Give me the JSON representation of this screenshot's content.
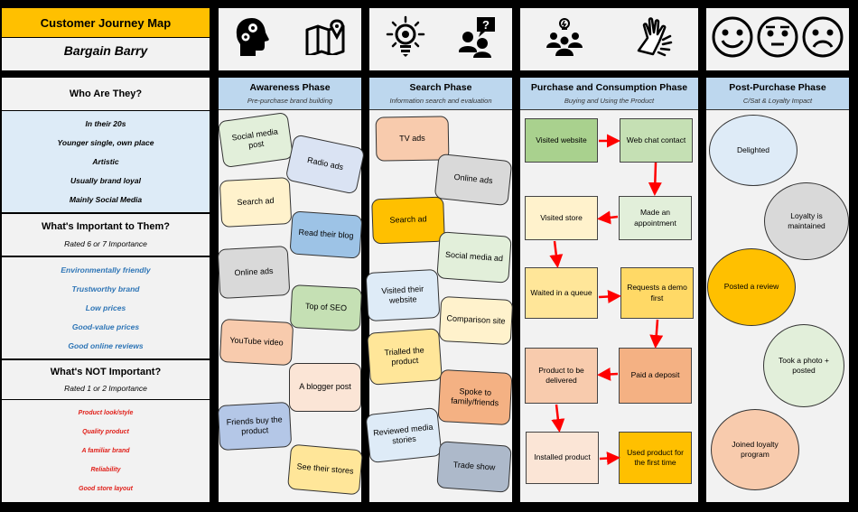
{
  "header": {
    "title": "Customer Journey Map",
    "persona": "Bargain Barry"
  },
  "left": {
    "who": {
      "heading": "Who Are They?",
      "items": [
        "In their 20s",
        "Younger single, own place",
        "Artistic",
        "Usually brand loyal",
        "Mainly Social Media"
      ]
    },
    "important": {
      "heading": "What's Important to Them?",
      "subheading": "Rated 6 or 7 Importance",
      "items": [
        "Environmentally friendly",
        "Trustworthy brand",
        "Low prices",
        "Good-value prices",
        "Good online reviews"
      ]
    },
    "not_important": {
      "heading": "What's NOT Important?",
      "subheading": "Rated 1 or 2 Importance",
      "items": [
        "Product look/style",
        "Quality product",
        "A familiar brand",
        "Reliability",
        "Good store layout"
      ]
    }
  },
  "phases": [
    {
      "title": "Awareness Phase",
      "subtitle": "Pre-purchase brand building",
      "icons": [
        "head-gears-icon",
        "map-pin-icon"
      ],
      "cards": [
        {
          "label": "Social media post",
          "color": "#e2efda"
        },
        {
          "label": "Radio ads",
          "color": "#dae3f3"
        },
        {
          "label": "Search ad",
          "color": "#fff2cc"
        },
        {
          "label": "Read their blog",
          "color": "#9dc3e6"
        },
        {
          "label": "Online ads",
          "color": "#d9d9d9"
        },
        {
          "label": "Top of SEO",
          "color": "#c5e0b4"
        },
        {
          "label": "YouTube video",
          "color": "#f8cbad"
        },
        {
          "label": "A blogger post",
          "color": "#fbe5d6"
        },
        {
          "label": "Friends buy the product",
          "color": "#b4c7e7"
        },
        {
          "label": "See their stores",
          "color": "#ffe699"
        }
      ]
    },
    {
      "title": "Search Phase",
      "subtitle": "Information search and evaluation",
      "icons": [
        "lightbulb-gear-icon",
        "people-question-icon"
      ],
      "cards": [
        {
          "label": "TV ads",
          "color": "#f8cbad"
        },
        {
          "label": "Online ads",
          "color": "#d9d9d9"
        },
        {
          "label": "Search ad",
          "color": "#ffc000"
        },
        {
          "label": "Social media ad",
          "color": "#e2efda"
        },
        {
          "label": "Visited their website",
          "color": "#deebf7"
        },
        {
          "label": "Comparison site",
          "color": "#fff2cc"
        },
        {
          "label": "Trialled the product",
          "color": "#ffe699"
        },
        {
          "label": "Spoke to family/friends",
          "color": "#f4b183"
        },
        {
          "label": "Reviewed media stories",
          "color": "#deebf7"
        },
        {
          "label": "Trade show",
          "color": "#adb9ca"
        }
      ]
    },
    {
      "title": "Purchase and Consumption Phase",
      "subtitle": "Buying and Using the Product",
      "icons": [
        "team-idea-icon",
        "hands-icon"
      ],
      "steps": [
        {
          "label": "Visited website",
          "color": "#a9d18e"
        },
        {
          "label": "Web chat contact",
          "color": "#c5e0b4"
        },
        {
          "label": "Made an appointment",
          "color": "#e2efda"
        },
        {
          "label": "Visited store",
          "color": "#fff2cc"
        },
        {
          "label": "Waited in a queue",
          "color": "#ffe699"
        },
        {
          "label": "Requests a demo first",
          "color": "#ffd966"
        },
        {
          "label": "Paid a deposit",
          "color": "#f4b183"
        },
        {
          "label": "Product to be delivered",
          "color": "#f8cbad"
        },
        {
          "label": "Installed product",
          "color": "#fbe5d6"
        },
        {
          "label": "Used product for the first time",
          "color": "#ffc000"
        }
      ],
      "arrow_color": "#ff0000"
    },
    {
      "title": "Post-Purchase Phase",
      "subtitle": "C/Sat & Loyalty Impact",
      "icons": [
        "happy-face-icon",
        "neutral-face-icon",
        "sad-face-icon"
      ],
      "outcomes": [
        {
          "label": "Delighted",
          "color": "#deebf7"
        },
        {
          "label": "Loyalty is maintained",
          "color": "#d9d9d9"
        },
        {
          "label": "Posted a review",
          "color": "#ffc000"
        },
        {
          "label": "Took a photo + posted",
          "color": "#e2efda"
        },
        {
          "label": "Joined loyalty program",
          "color": "#f8cbad"
        }
      ]
    }
  ],
  "colors": {
    "title_bar": "#ffc000",
    "phase_header": "#bdd7ee",
    "panel": "#f2f2f2",
    "important_text": "#2e75b6",
    "not_important_text": "#e0201a"
  }
}
